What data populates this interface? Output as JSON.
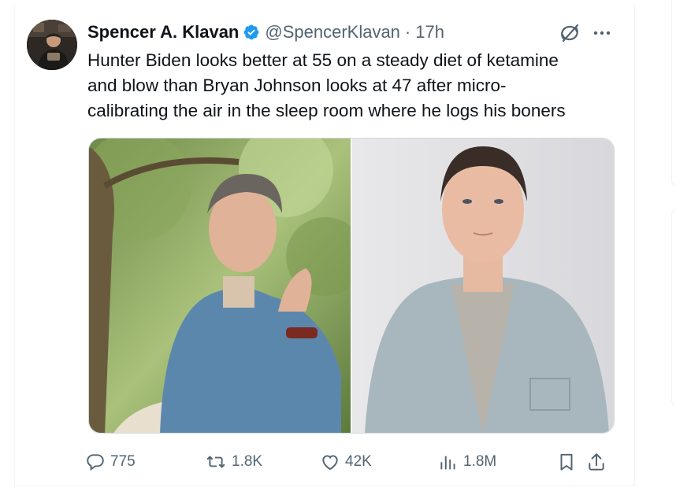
{
  "tweet": {
    "author": {
      "display_name": "Spencer A. Klavan",
      "handle": "@SpencerKlavan",
      "separator": "·",
      "time": "17h",
      "verified_icon": "verified-badge-icon",
      "avatar": "avatar"
    },
    "text_lines": [
      "Hunter Biden looks better at 55 on a steady diet of ketamine",
      "and blow than Bryan Johnson looks at 47 after micro-",
      "calibrating the air in the sleep room where he logs his boners"
    ],
    "header_icons": [
      "grok-icon",
      "more-options-icon"
    ],
    "media": {
      "count": 2,
      "left_image": "photo of man in denim shirt seated outdoors",
      "right_image": "photo of man in grey corduroy shirt against light background"
    },
    "actions": {
      "replies": "775",
      "reposts": "1.8K",
      "likes": "42K",
      "views": "1.8M",
      "icons": [
        "reply-icon",
        "repost-icon",
        "like-icon",
        "views-icon",
        "bookmark-icon",
        "share-icon"
      ]
    },
    "colors": {
      "text": "#0f1419",
      "secondary": "#536471",
      "verified": "#1d9bf0",
      "border": "#eff3f4"
    }
  }
}
